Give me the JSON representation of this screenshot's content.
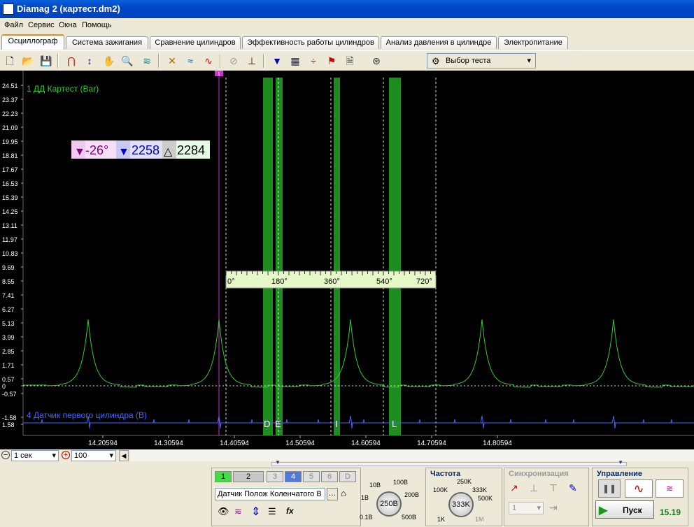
{
  "window": {
    "title": "Diamag 2 (картест.dm2)"
  },
  "menu": [
    "Файл",
    "Сервис",
    "Окна",
    "Помощь"
  ],
  "tabs": [
    {
      "label": "Осциллограф",
      "active": true
    },
    {
      "label": "Система зажигания"
    },
    {
      "label": "Сравнение цилиндров"
    },
    {
      "label": "Эффективность работы цилиндров"
    },
    {
      "label": "Анализ давления в цилиндре"
    },
    {
      "label": "Электропитание"
    }
  ],
  "toolbar": {
    "test_select": "Выбор теста"
  },
  "plot": {
    "channel1_label": "1 ДД Картест (Bar)",
    "channel4_label": "4 Датчик первого цилиндра (В)",
    "y_ticks": [
      "24.51",
      "23.37",
      "22.23",
      "21.09",
      "19.95",
      "18.81",
      "17.67",
      "16.53",
      "15.39",
      "14.25",
      "13.11",
      "11.97",
      "10.83",
      "9.69",
      "8.55",
      "7.41",
      "6.27",
      "5.13",
      "3.99",
      "2.85",
      "1.71",
      "0.57",
      "0",
      "-0.57",
      "-1.58",
      "1.58"
    ],
    "x_ticks": [
      "14.20594",
      "14.30594",
      "14.40594",
      "14.50594",
      "14.60594",
      "14.70594",
      "14.80594"
    ],
    "cursor_marker": "1",
    "meas_angle": "-26°",
    "meas_value": "2258",
    "meas_delta": "2284",
    "scale_labels": [
      "0°",
      "180°",
      "360°",
      "540°",
      "720°"
    ],
    "phase_labels": [
      "D",
      "E",
      "I",
      "L"
    ],
    "colors": {
      "channel1": "#33cc33",
      "channel4": "#4466ff",
      "cursor": "#cc33cc",
      "bands": "#1e8c1e"
    }
  },
  "bottom": {
    "time_select": "1 сек",
    "zoom_select": "100"
  },
  "panel": {
    "channels": [
      "1",
      "2",
      "3",
      "4",
      "5",
      "6",
      "D"
    ],
    "sensor": "Датчик Полож Коленчатого В",
    "range_labels": [
      "10В",
      "100В",
      "1В",
      "200В",
      "0.1В",
      "500В"
    ],
    "range_value": "250В",
    "freq_title": "Частота",
    "freq_labels": [
      "250K",
      "100K",
      "333K",
      "500K",
      "1K",
      "1M"
    ],
    "freq_value": "333K",
    "sync_title": "Синхронизация",
    "sync_value": "1",
    "control_title": "Управление",
    "start_label": "Пуск",
    "fps": "15.19"
  }
}
